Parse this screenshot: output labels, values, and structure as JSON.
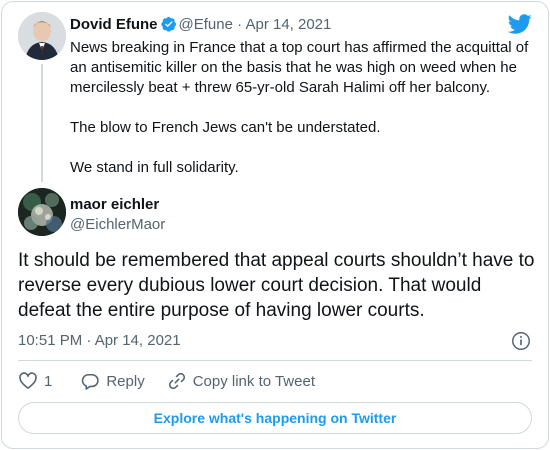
{
  "colors": {
    "accent": "#1d9bf0",
    "muted": "#536471",
    "border": "#cfd9de",
    "text": "#0f1419"
  },
  "quoted_tweet": {
    "author_name": "Dovid Efune",
    "handle": "@Efune",
    "separator": "·",
    "date": "Apr 14, 2021",
    "paragraphs": [
      "News breaking in France that a top court has affirmed the acquittal of an antisemitic killer on the basis that he was high on weed when he mercilessly beat + threw 65-yr-old Sarah Halimi off her balcony.",
      "The blow to French Jews can't be understated.",
      "We stand in full solidarity."
    ]
  },
  "main_tweet": {
    "author_name": "maor eichler",
    "handle": "@EichlerMaor",
    "text": "It should be remembered that appeal courts shouldn’t have to reverse every dubious lower court decision. That would defeat the entire purpose of having lower courts.",
    "timestamp": "10:51 PM · Apr 14, 2021"
  },
  "actions": {
    "like_count": "1",
    "reply_label": "Reply",
    "copy_link_label": "Copy link to Tweet"
  },
  "explore_label": "Explore what's happening on Twitter",
  "icons": [
    "twitter-bird-icon",
    "verified-badge-icon",
    "info-icon",
    "heart-icon",
    "reply-icon",
    "link-icon"
  ]
}
